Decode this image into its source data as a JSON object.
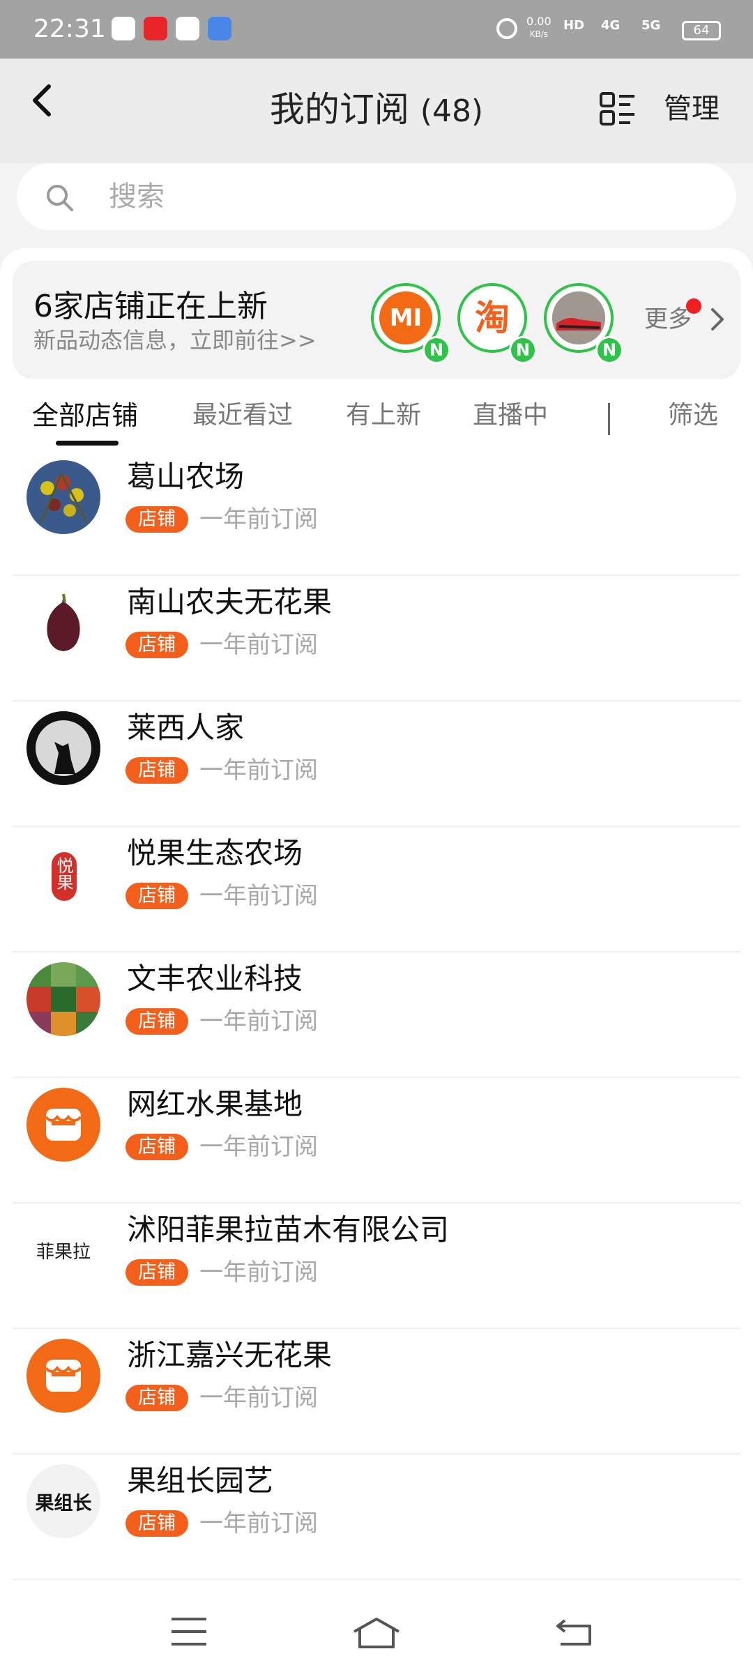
{
  "status_bar": {
    "time": "22:31",
    "speed_value": "0.00",
    "speed_unit": "KB/s",
    "hd": "HD",
    "net1": "4G",
    "net2": "5G",
    "battery": "64"
  },
  "header": {
    "title": "我的订阅",
    "count": "(48)",
    "manage_label": "管理"
  },
  "search": {
    "placeholder": "搜索"
  },
  "new_arrivals": {
    "title": "6家店铺正在上新",
    "subtitle": "新品动态信息，立即前往>>",
    "more_label": "更多",
    "badge": "N",
    "shops": [
      {
        "icon": "mi-logo",
        "text": "MI",
        "color": "#f26b14"
      },
      {
        "icon": "taobao-logo",
        "text": "淘",
        "color": "#f4601c"
      },
      {
        "icon": "shoe-photo",
        "text": "",
        "color": "#777777"
      }
    ]
  },
  "tabs": [
    "全部店铺",
    "最近看过",
    "有上新",
    "直播中",
    "筛选"
  ],
  "active_tab": "全部店铺",
  "tag_label": "店铺",
  "subscriptions": [
    {
      "name": "葛山农场",
      "tag": "店铺",
      "time": "一年前订阅",
      "avatar": "berry-photo"
    },
    {
      "name": "南山农夫无花果",
      "tag": "店铺",
      "time": "一年前订阅",
      "avatar": "fig-photo"
    },
    {
      "name": "莱西人家",
      "tag": "店铺",
      "time": "一年前订阅",
      "avatar": "wolf-moon-photo"
    },
    {
      "name": "悦果生态农场",
      "tag": "店铺",
      "time": "一年前订阅",
      "avatar": "yueguo-logo",
      "logo_text": "悦果"
    },
    {
      "name": "文丰农业科技",
      "tag": "店铺",
      "time": "一年前订阅",
      "avatar": "fruit-grid-photo"
    },
    {
      "name": "网红水果基地",
      "tag": "店铺",
      "time": "一年前订阅",
      "avatar": "store-default-icon"
    },
    {
      "name": "沭阳菲果拉苗木有限公司",
      "tag": "店铺",
      "time": "一年前订阅",
      "avatar": "feiguola-logo",
      "logo_text": "菲果拉"
    },
    {
      "name": "浙江嘉兴无花果",
      "tag": "店铺",
      "time": "一年前订阅",
      "avatar": "store-default-icon"
    },
    {
      "name": "果组长园艺",
      "tag": "店铺",
      "time": "一年前订阅",
      "avatar": "guozuzhang-logo",
      "logo_text": "果组长"
    }
  ],
  "colors": {
    "accent": "#f4601c",
    "new_badge": "#2fc34a",
    "notification_dot": "#f01e1e"
  }
}
